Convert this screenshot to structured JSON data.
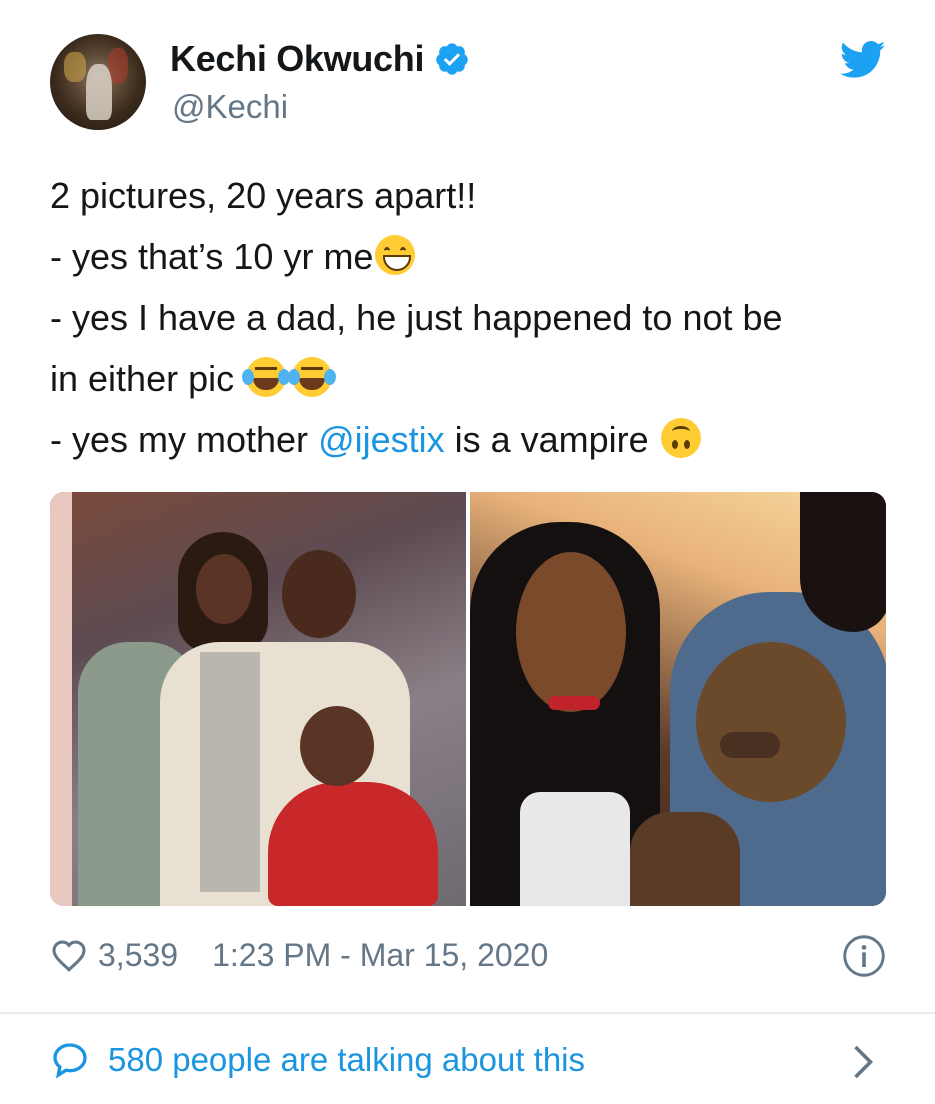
{
  "author": {
    "name": "Kechi Okwuchi",
    "handle": "@Kechi",
    "verified": true
  },
  "tweet": {
    "lines": [
      {
        "text": "2 pictures, 20 years apart!!"
      },
      {
        "text": "- yes that’s 10 yr me",
        "emoji": "grinning-squinting-face"
      },
      {
        "text": "- yes I have a dad, he just happened to not be"
      },
      {
        "text": "in either pic ",
        "emoji": "face-with-tears-of-joy x2"
      },
      {
        "before": "- yes my mother ",
        "mention": "@ijestix",
        "after": " is a vampire ",
        "emoji": "upside-down-face"
      }
    ]
  },
  "media": [
    {
      "name": "photo-past",
      "icon": "family-photo"
    },
    {
      "name": "photo-present",
      "icon": "selfie-photo"
    }
  ],
  "meta": {
    "likes": "3,539",
    "timestamp": "1:23 PM - Mar 15, 2020"
  },
  "footer": {
    "talking": "580 people are talking about this"
  },
  "colors": {
    "accent": "#1b95e0",
    "text": "#14171a",
    "muted": "#657786",
    "divider": "#e6ecf0",
    "twitter_blue": "#1da1f2"
  },
  "icons": [
    "verified-badge-icon",
    "twitter-bird-icon",
    "heart-icon",
    "info-icon",
    "speech-bubble-icon",
    "chevron-right-icon"
  ]
}
